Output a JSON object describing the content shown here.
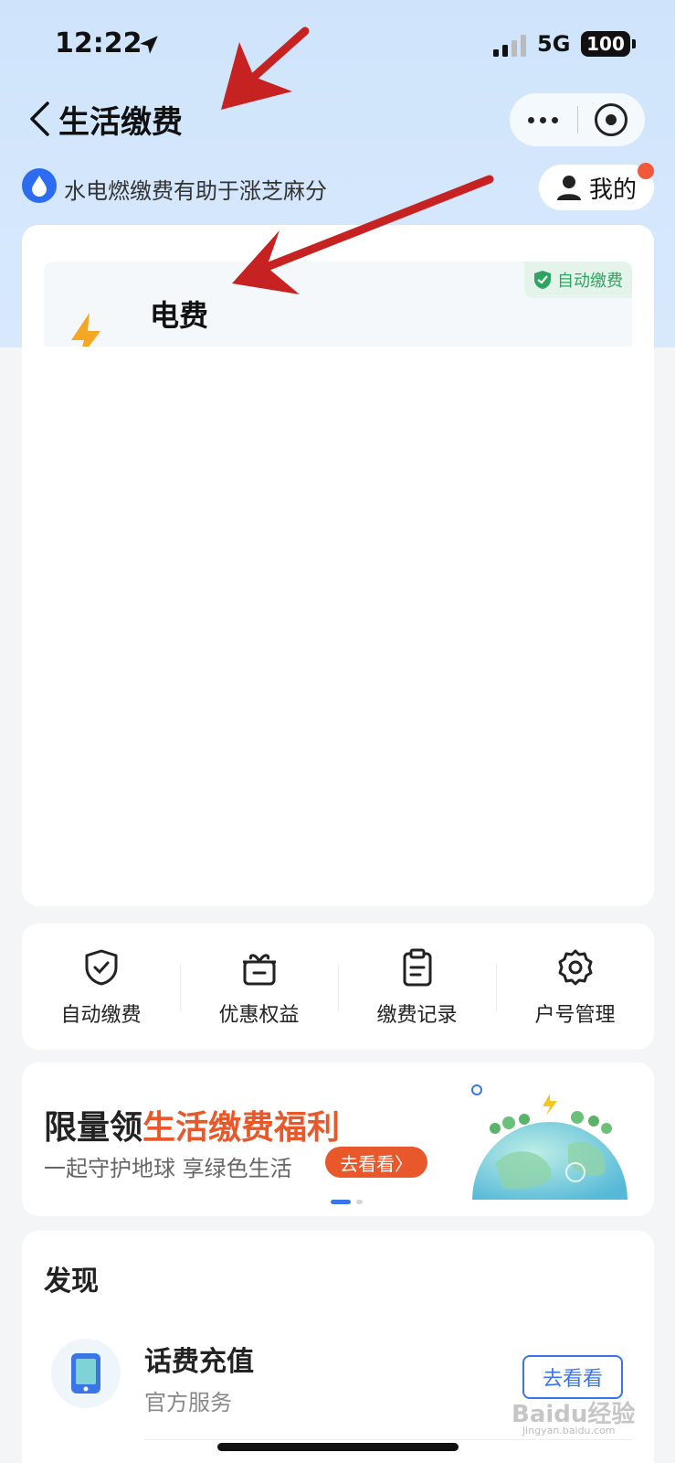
{
  "status_bar": {
    "time": "12:22",
    "network": "5G",
    "battery": "100"
  },
  "nav": {
    "title": "生活缴费"
  },
  "zhima": {
    "text": "水电燃缴费有助于涨芝麻分"
  },
  "mine_button": {
    "label": "我的"
  },
  "bill": {
    "title": "电费",
    "tag": "自动缴费"
  },
  "actions": [
    {
      "label": "自动缴费",
      "icon": "shield-check-icon"
    },
    {
      "label": "优惠权益",
      "icon": "gift-icon"
    },
    {
      "label": "缴费记录",
      "icon": "clipboard-icon"
    },
    {
      "label": "户号管理",
      "icon": "gear-icon"
    }
  ],
  "banner": {
    "title_prefix": "限量领",
    "title_highlight": "生活缴费福利",
    "subtitle": "一起守护地球 享绿色生活",
    "button": "去看看",
    "button_suffix": "〉"
  },
  "discover": {
    "title": "发现",
    "item": {
      "name": "话费充值",
      "desc": "官方服务",
      "button": "去看看"
    }
  },
  "watermark": {
    "main": "Baidu经验",
    "sub": "jingyan.baidu.com"
  },
  "colors": {
    "accent": "#3a75e8",
    "highlight": "#e8582a",
    "header_bg": "#cfe4fb",
    "annotation_arrow": "#c62222"
  }
}
